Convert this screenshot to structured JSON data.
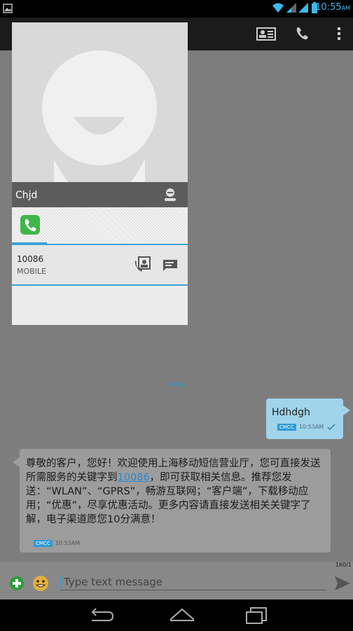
{
  "status_bar": {
    "time": "10:55",
    "ampm": "AM"
  },
  "action_bar": {
    "contact_card_icon": "contact-card-icon",
    "call_icon": "phone-icon",
    "overflow_icon": "overflow-menu-icon"
  },
  "quick_contact": {
    "name": "Chjd",
    "phone_number": "10086",
    "phone_type": "MOBILE"
  },
  "conversation": {
    "date_divider": "Today",
    "outgoing": {
      "text": "Hdhdgh",
      "carrier": "CMCC",
      "time": "10:53AM"
    },
    "incoming": {
      "text_before_link": "尊敬的客户，您好！欢迎使用上海移动短信营业厅，您可直接发送所需服务的关键字到",
      "link": "10086",
      "text_after_link": "，即可获取相关信息。推荐您发送：“WLAN”、“GPRS”，畅游互联网；“客户端”，下载移动应用；“优惠”，尽享优惠活动。更多内容请直接发送相关关键字了解，电子渠道愿您10分满意！",
      "carrier": "CMCC",
      "time": "10:53AM"
    }
  },
  "compose": {
    "placeholder": "Type text message",
    "char_counter": "160/1"
  },
  "colors": {
    "accent": "#3ea3d6",
    "outgoing_bubble": "#9fd4ea",
    "incoming_bubble": "#9c9c9c"
  }
}
